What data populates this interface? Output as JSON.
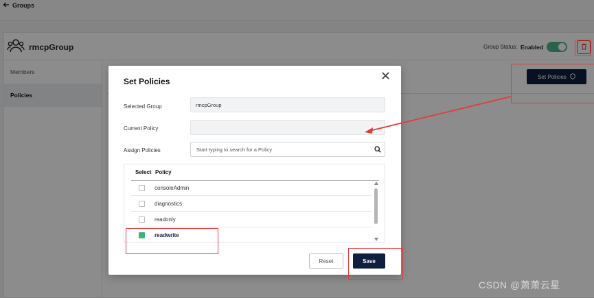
{
  "topbar": {
    "back_label": "Groups"
  },
  "group": {
    "name": "rmcpGroup",
    "status_label": "Group Status:",
    "status_value": "Enabled"
  },
  "sidebar": {
    "items": [
      {
        "label": "Members"
      },
      {
        "label": "Policies"
      }
    ]
  },
  "content": {
    "set_policies_label": "Set Policies"
  },
  "modal": {
    "title": "Set Policies",
    "selected_group_label": "Selected Group",
    "selected_group_value": "rmcpGroup",
    "current_policy_label": "Current Policy",
    "current_policy_value": "",
    "assign_policies_label": "Assign Policies",
    "search_placeholder": "Start typing to search for a Policy",
    "table": {
      "headers": [
        "Select",
        "Policy"
      ],
      "rows": [
        {
          "name": "consoleAdmin",
          "checked": false
        },
        {
          "name": "diagnostics",
          "checked": false
        },
        {
          "name": "readonly",
          "checked": false
        },
        {
          "name": "readwrite",
          "checked": true
        }
      ]
    },
    "reset_label": "Reset",
    "save_label": "Save"
  },
  "watermark": "CSDN @萧萧云星",
  "colors": {
    "accent": "#0f1f3d",
    "toggle": "#4cb48a",
    "check": "#3fb37f",
    "annotation": "#e23b3b"
  }
}
